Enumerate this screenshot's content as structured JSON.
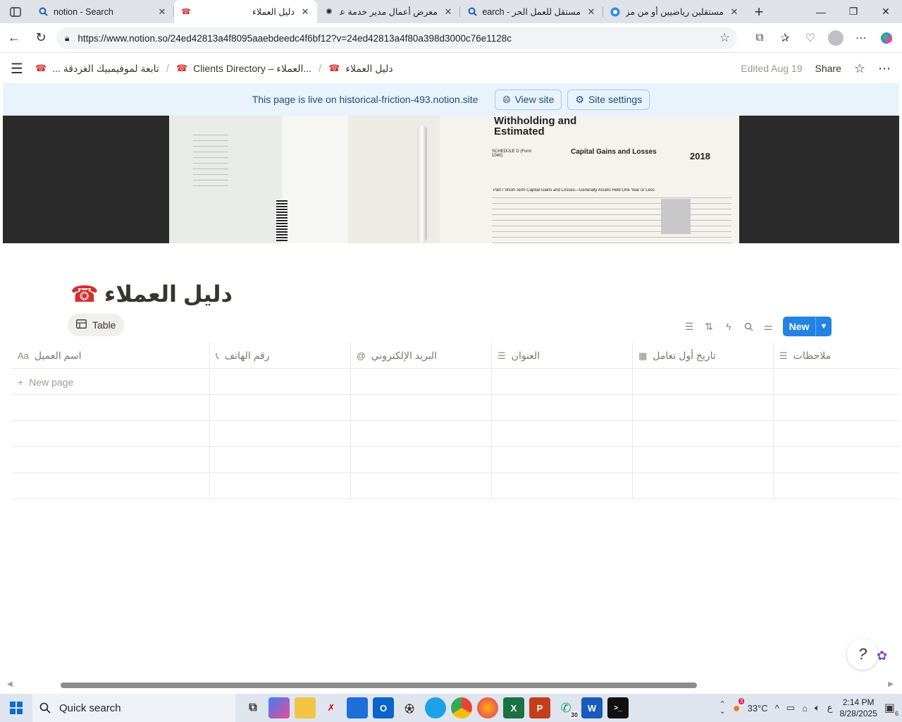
{
  "browser": {
    "tabs": [
      {
        "title": "notion - Search",
        "rtl": false,
        "icon": "search-icon"
      },
      {
        "title": "دليل العملاء",
        "rtl": true,
        "icon": "telephone-icon",
        "active": true
      },
      {
        "title": "معرض أعمال مدير خدمة عملا",
        "rtl": true,
        "icon": "openai-icon"
      },
      {
        "title": "مستقل للعمل الحر - Search",
        "rtl": true,
        "icon": "search-icon"
      },
      {
        "title": "مستقلين رياضيين أو من مزا",
        "rtl": true,
        "icon": "site-icon"
      }
    ],
    "url": "https://www.notion.so/24ed42813a4f8095aaebdeedc4f6bf12?v=24ed42813a4f80a398d3000c76e1128c"
  },
  "notion": {
    "breadcrumbs": [
      {
        "label": "تابعة لموفيمبيك الغردقة ..."
      },
      {
        "label": "Clients Directory – العملاء..."
      },
      {
        "label": "دليل العملاء"
      }
    ],
    "edited": "Edited Aug 19",
    "share": "Share",
    "banner": {
      "message": "This page is live on historical-friction-493.notion.site",
      "view_site": "View site",
      "site_settings": "Site settings"
    },
    "title": "دليل العملاء",
    "view_tab": "Table",
    "new_button": "New",
    "columns": [
      {
        "label": "اسم العميل",
        "icon": "Aa"
      },
      {
        "label": "رقم الهاتف",
        "icon": "phone-icon"
      },
      {
        "label": "البريد الإلكتروني",
        "icon": "at-icon"
      },
      {
        "label": "العنوان",
        "icon": "text-icon"
      },
      {
        "label": "تاريخ أول تعامل",
        "icon": "calendar-icon"
      },
      {
        "label": "ملاحظات",
        "icon": "text-icon"
      }
    ],
    "new_page": "New page"
  },
  "cover_text": {
    "heading": "Withholding and Estimated",
    "form_title": "Capital Gains and Losses",
    "schedule": "SCHEDULE D (Form 1040)",
    "year": "2018",
    "part": "Part I  Short-Term Capital Gains and Losses—Generally Assets Held One Year or Less"
  },
  "taskbar": {
    "search": "Quick search",
    "temp": "33°C",
    "lang": "ع",
    "time": "2:14 PM",
    "date": "8/28/2025",
    "notif": "6",
    "whatsapp_badge": "30",
    "weather_badge": "3"
  }
}
